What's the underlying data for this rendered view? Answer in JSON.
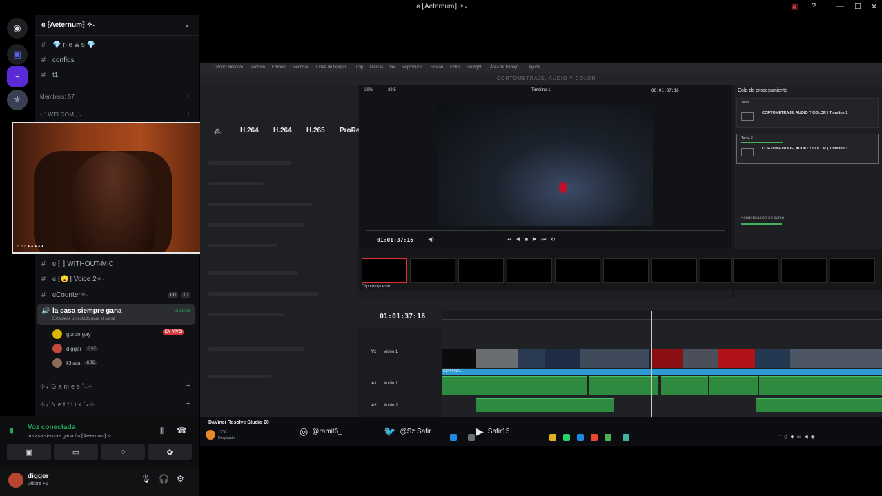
{
  "window": {
    "title": "ɞ ⁅Aeternum⁆ ✧˖"
  },
  "server": {
    "name": "ɞ ⁅Aeternum⁆ ✧˖",
    "channels_top": [
      {
        "icon": "#",
        "label": "💎 n e w s 💎"
      },
      {
        "icon": "#",
        "label": "configs"
      },
      {
        "icon": "#",
        "label": "t1"
      }
    ],
    "members_label": "Members: 57",
    "welcome_label": "-ˏˋ WELCOM ˎˊ˗",
    "voice_channels": [
      {
        "label": "ɞ ⁅ ⁆ WITHOUT-MIC"
      },
      {
        "label": "ɞ ⁅😮⁆ Voice 2✧˖"
      },
      {
        "label": "ɞCounter✧˖",
        "badge_a": "00",
        "badge_b": "10"
      }
    ],
    "active_channel": {
      "label": "la casa siempre gana",
      "status": "Establece un estado para el canal",
      "time": "0:21:01",
      "members": [
        {
          "name": "gordo gay",
          "tag": "EN VIVO"
        },
        {
          "name": "digger",
          "tag": "CSZ"
        },
        {
          "name": "Khala",
          "tag": "KRD"
        }
      ]
    },
    "categories": [
      "⊹₊˚G a m e s ˚₊⊹",
      "⊹₊˚N e t f l i x ˚₊⊹"
    ]
  },
  "voice_panel": {
    "status": "Voz conectada",
    "location": "la casa siempre gana / ɞ ⁅Aeternum⁆ ✧˖",
    "user_name": "digger",
    "user_status": "Dillore +1"
  },
  "resolve": {
    "menu": [
      "DaVinci Resolve",
      "Archivo",
      "Edición",
      "Recortar",
      "Línea de tiempo",
      "Clip",
      "Marcas",
      "Ver",
      "Reproducir",
      "Fusion",
      "Color",
      "Fairlight",
      "Área de trabajo",
      "Ayuda"
    ],
    "project_title": "CORTOMETRAJE, AUDIO Y COLOR",
    "zoom": "39%",
    "fps": "23.5",
    "timeline_name": "Timeline 1",
    "viewer_tc": "01:01:37:16",
    "top_tc": "00:01:37:16",
    "codecs": [
      "H.264",
      "H.264",
      "H.265",
      "ProRes"
    ],
    "render_queue_title": "Cola de procesamiento",
    "jobs": [
      {
        "name": "Tarea 1",
        "title": "CORTOMETRAJE, AUDIO Y COLOR | Timeline 1"
      },
      {
        "name": "Tarea 2",
        "title": "CORTOMETRAJE, AUDIO Y COLOR | Timeline 1"
      }
    ],
    "render_label": "Renderización en curso",
    "clip_label": "Clip compuesto",
    "timeline_tc": "01:01:37:16",
    "tracks": {
      "v1": "V1",
      "v1_name": "Video 1",
      "a1": "A1",
      "a1_name": "Audio 1",
      "a2": "A2",
      "a2_name": "Audio 2",
      "clip_final": "CLIP FINAL"
    },
    "app_name": "DaVinci Resolve Studio 20"
  },
  "taskbar": {
    "social": [
      {
        "icon": "instagram-icon",
        "label": "@ramit6_"
      },
      {
        "icon": "twitter-icon",
        "label": "@Sz Safir"
      },
      {
        "icon": "youtube-icon",
        "label": "Safir15"
      }
    ],
    "weather": "17°C",
    "weather_sub": "Despejado"
  }
}
